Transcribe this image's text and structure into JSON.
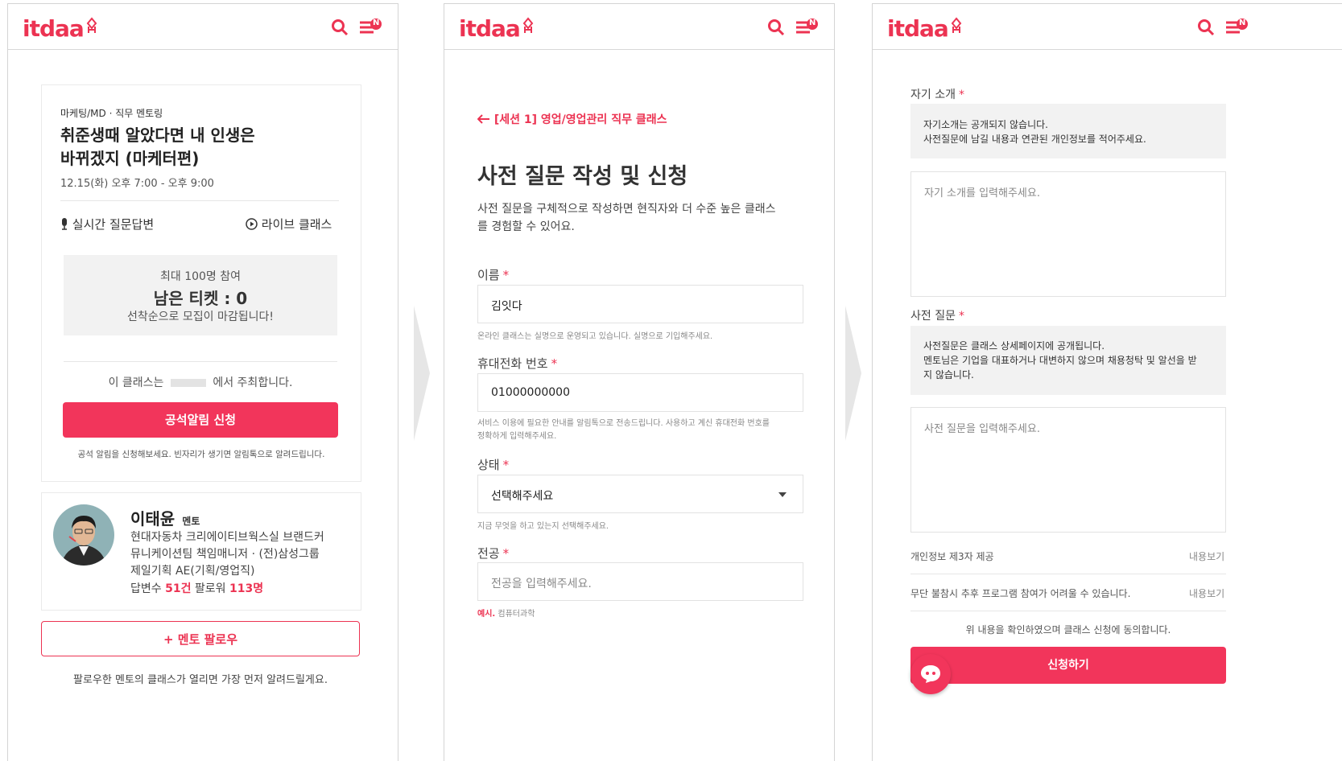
{
  "logo": "itdaa",
  "badge": "N",
  "screen1": {
    "category": "마케팅/MD · 직무 멘토링",
    "title_line1": "취준생때 알았다면 내 인생은",
    "title_line2": "바뀌겠지 (마케터편)",
    "datetime": "12.15(화) 오후 7:00 - 오후 9:00",
    "feature_left": "실시간 질문답변",
    "feature_right": "라이브 클래스",
    "capacity": "최대 100명 참여",
    "tickets_label": "남은 티켓 : 0",
    "closing_note": "선착순으로 모집이 마감됩니다!",
    "host_prefix": "이 클래스는",
    "host_suffix": "에서 주최합니다.",
    "vacancy_button": "공석알림 신청",
    "vacancy_note": "공석 알림을 신청해보세요. 빈자리가 생기면 알림톡으로 알려드립니다.",
    "mentor_name": "이태윤",
    "mentor_badge": "멘토",
    "mentor_desc_1": "현대자동차 크리에이티브웍스실 브랜드커",
    "mentor_desc_2": "뮤니케이션팀 책임매니저 · (전)삼성그룹",
    "mentor_desc_3": "제일기획 AE(기획/영업직)",
    "answers_label": "답변수",
    "answers_value": "51건",
    "followers_label": "팔로워",
    "followers_value": "113명",
    "follow_button": "+ 멘토 팔로우",
    "follow_note": "팔로우한 멘토의 클래스가 열리면 가장 먼저 알려드릴게요."
  },
  "screen2": {
    "back_link": "[세션 1] 영업/영업관리 직무 클래스",
    "heading": "사전 질문 작성 및 신청",
    "intro_1": "사전 질문을 구체적으로 작성하면 현직자와 더 수준 높은 클래스",
    "intro_2": "를 경험할 수 있어요.",
    "name_label": "이름",
    "name_value": "김잇다",
    "name_hint": "온라인 클래스는 실명으로 운영되고 있습니다. 실명으로 기입해주세요.",
    "phone_label": "휴대전화 번호",
    "phone_value": "01000000000",
    "phone_hint_1": "서비스 이용에 필요한 안내를 알림톡으로 전송드립니다. 사용하고 계신 휴대전화 번호를",
    "phone_hint_2": "정확하게 입력해주세요.",
    "status_label": "상태",
    "status_value": "선택해주세요",
    "status_hint": "지금 무엇을 하고 있는지 선택해주세요.",
    "major_label": "전공",
    "major_placeholder": "전공을 입력해주세요.",
    "major_example_prefix": "예시.",
    "major_example": "컴퓨터과학",
    "required_mark": "*"
  },
  "screen3": {
    "intro_label": "자기 소개",
    "intro_notice_1": "자기소개는 공개되지 않습니다.",
    "intro_notice_2": "사전질문에 남길 내용과 연관된 개인정보를 적어주세요.",
    "intro_placeholder": "자기 소개를 입력해주세요.",
    "question_label": "사전 질문",
    "question_notice_1": "사전질문은 클래스 상세페이지에 공개됩니다.",
    "question_notice_2": "멘토님은 기업을 대표하거나 대변하지 않으며 채용청탁 및 알선을 받",
    "question_notice_3": "지 않습니다.",
    "question_placeholder": "사전 질문을 입력해주세요.",
    "term1": "개인정보 제3자 제공",
    "term2": "무단 불참시 추후 프로그램 참여가 어려울 수 있습니다.",
    "view_link": "내용보기",
    "consent": "위 내용을 확인하였으며 클래스 신청에 동의합니다.",
    "submit": "신청하기",
    "required_mark": "*"
  },
  "colors": {
    "accent": "#ec3352",
    "button": "#f2355b",
    "gray_box": "#f2f2f2"
  }
}
